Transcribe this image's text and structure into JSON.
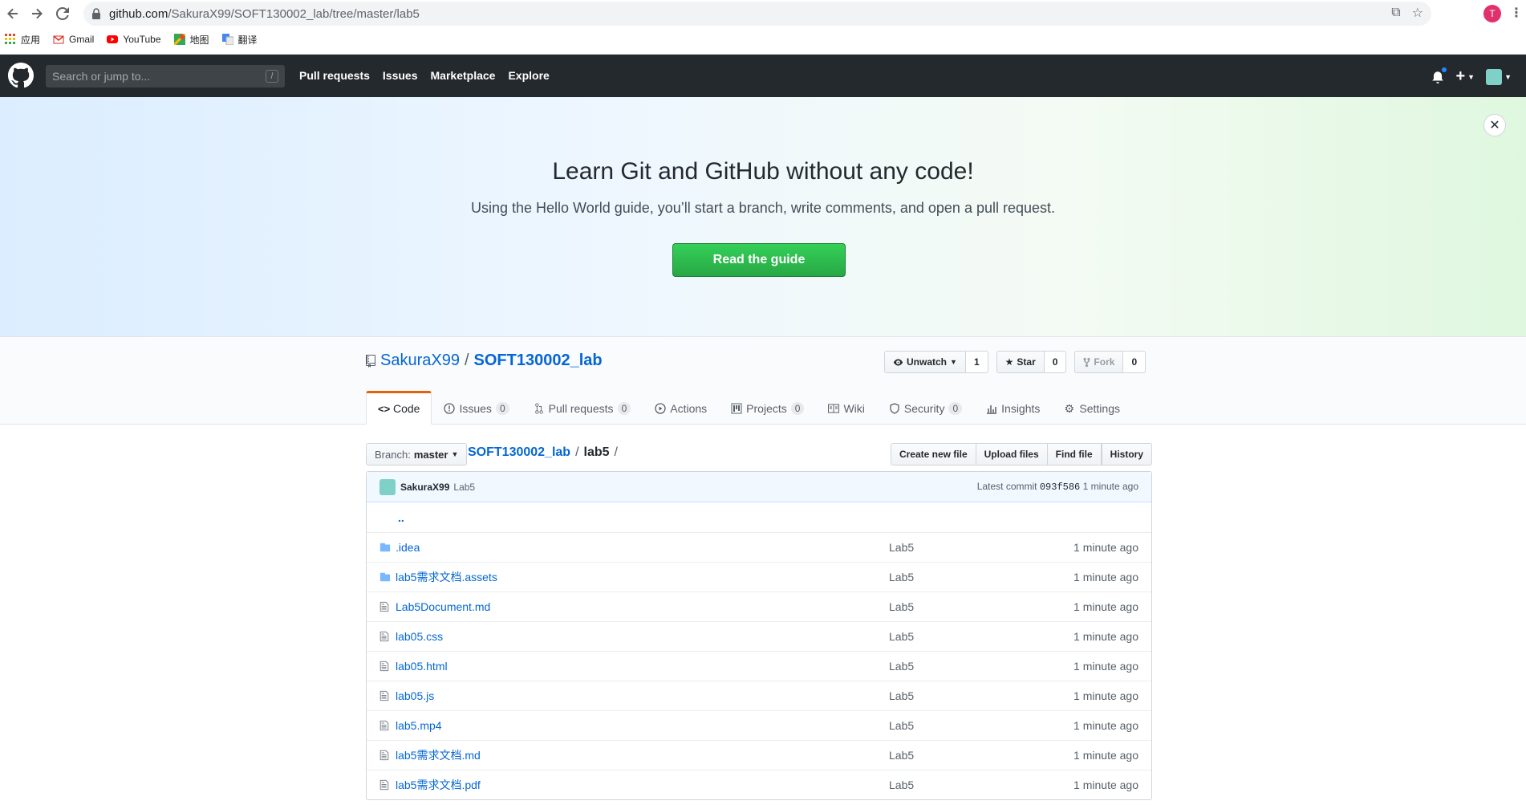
{
  "browser": {
    "url_host": "github.com",
    "url_path": "/SakuraX99/SOFT130002_lab/tree/master/lab5",
    "profile_initial": "T",
    "bookmarks": [
      {
        "label": "应用",
        "icon": "apps-grid-icon"
      },
      {
        "label": "Gmail",
        "icon": "gmail-icon"
      },
      {
        "label": "YouTube",
        "icon": "youtube-icon"
      },
      {
        "label": "地图",
        "icon": "maps-icon"
      },
      {
        "label": "翻译",
        "icon": "translate-icon"
      }
    ]
  },
  "header": {
    "search_placeholder": "Search or jump to...",
    "search_shortcut": "/",
    "nav": [
      "Pull requests",
      "Issues",
      "Marketplace",
      "Explore"
    ]
  },
  "banner": {
    "title": "Learn Git and GitHub without any code!",
    "subtitle": "Using the Hello World guide, you’ll start a branch, write comments, and open a pull request.",
    "button": "Read the guide",
    "close": "✕"
  },
  "repo": {
    "owner": "SakuraX99",
    "separator": "/",
    "name": "SOFT130002_lab",
    "watch_label": "Unwatch",
    "watch_count": "1",
    "star_label": "Star",
    "star_count": "0",
    "fork_label": "Fork",
    "fork_count": "0"
  },
  "tabs": [
    {
      "label": "Code",
      "count": null,
      "icon": "code-icon"
    },
    {
      "label": "Issues",
      "count": "0",
      "icon": "issue-icon"
    },
    {
      "label": "Pull requests",
      "count": "0",
      "icon": "pull-request-icon"
    },
    {
      "label": "Actions",
      "count": null,
      "icon": "actions-icon"
    },
    {
      "label": "Projects",
      "count": "0",
      "icon": "projects-icon"
    },
    {
      "label": "Wiki",
      "count": null,
      "icon": "wiki-icon"
    },
    {
      "label": "Security",
      "count": "0",
      "icon": "shield-icon"
    },
    {
      "label": "Insights",
      "count": null,
      "icon": "graph-icon"
    },
    {
      "label": "Settings",
      "count": null,
      "icon": "gear-icon"
    }
  ],
  "file_nav": {
    "branch_label": "Branch:",
    "branch": "master",
    "crumb_repo": "SOFT130002_lab",
    "crumb_sep": "/",
    "crumb_current": "lab5",
    "crumb_trailing": "/",
    "actions": [
      "Create new file",
      "Upload files",
      "Find file",
      "History"
    ]
  },
  "commit": {
    "author": "SakuraX99",
    "message": "Lab5",
    "latest_label": "Latest commit",
    "sha": "093f586",
    "age": "1 minute ago"
  },
  "parent_link": "..",
  "files": [
    {
      "name": ".idea",
      "type": "dir",
      "message": "Lab5",
      "age": "1 minute ago"
    },
    {
      "name": "lab5需求文档.assets",
      "type": "dir",
      "message": "Lab5",
      "age": "1 minute ago"
    },
    {
      "name": "Lab5Document.md",
      "type": "file",
      "message": "Lab5",
      "age": "1 minute ago"
    },
    {
      "name": "lab05.css",
      "type": "file",
      "message": "Lab5",
      "age": "1 minute ago"
    },
    {
      "name": "lab05.html",
      "type": "file",
      "message": "Lab5",
      "age": "1 minute ago"
    },
    {
      "name": "lab05.js",
      "type": "file",
      "message": "Lab5",
      "age": "1 minute ago"
    },
    {
      "name": "lab5.mp4",
      "type": "file",
      "message": "Lab5",
      "age": "1 minute ago"
    },
    {
      "name": "lab5需求文档.md",
      "type": "file",
      "message": "Lab5",
      "age": "1 minute ago"
    },
    {
      "name": "lab5需求文档.pdf",
      "type": "file",
      "message": "Lab5",
      "age": "1 minute ago"
    }
  ],
  "colors": {
    "header_bg": "#24292e",
    "link": "#0366d6",
    "primary_button": "#28a745",
    "tab_accent": "#e36209"
  }
}
